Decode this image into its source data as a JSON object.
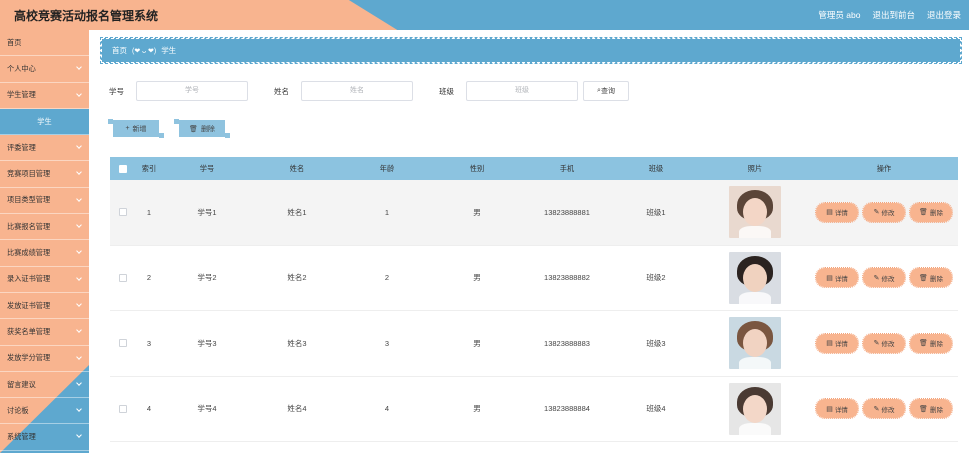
{
  "header": {
    "title": "高校竞赛活动报名管理系统",
    "admin": "管理员 abo",
    "front": "退出到前台",
    "logout": "退出登录"
  },
  "sidebar": {
    "items": [
      {
        "label": "首页",
        "chev": false,
        "active": false
      },
      {
        "label": "个人中心",
        "chev": true,
        "active": false
      },
      {
        "label": "学生管理",
        "chev": true,
        "active": false
      },
      {
        "label": "学生",
        "chev": false,
        "active": true
      },
      {
        "label": "评委管理",
        "chev": true,
        "active": false
      },
      {
        "label": "竞赛项目管理",
        "chev": true,
        "active": false
      },
      {
        "label": "项目类型管理",
        "chev": true,
        "active": false
      },
      {
        "label": "比赛报名管理",
        "chev": true,
        "active": false
      },
      {
        "label": "比赛成绩管理",
        "chev": true,
        "active": false
      },
      {
        "label": "录入证书管理",
        "chev": true,
        "active": false
      },
      {
        "label": "发放证书管理",
        "chev": true,
        "active": false
      },
      {
        "label": "获奖名单管理",
        "chev": true,
        "active": false
      },
      {
        "label": "发放学分管理",
        "chev": true,
        "active": false
      },
      {
        "label": "留言建议",
        "chev": true,
        "active": false
      },
      {
        "label": "讨论板",
        "chev": true,
        "active": false
      },
      {
        "label": "系统管理",
        "chev": true,
        "active": false
      }
    ]
  },
  "breadcrumb": {
    "home": "首页",
    "sep": "(❤ ᴗ ❤)",
    "current": "学生"
  },
  "search": {
    "no_label": "学号",
    "no_placeholder": "学号",
    "name_label": "姓名",
    "name_placeholder": "姓名",
    "class_label": "班级",
    "class_placeholder": "班级",
    "button": "查询"
  },
  "actions": {
    "add": "新增",
    "delete": "删除"
  },
  "table": {
    "headers": [
      "索引",
      "学号",
      "姓名",
      "年龄",
      "性别",
      "手机",
      "班级",
      "照片",
      "操作"
    ],
    "rows": [
      {
        "idx": "1",
        "no": "学号1",
        "name": "姓名1",
        "age": "1",
        "sex": "男",
        "phone": "13823888881",
        "cls": "班级1"
      },
      {
        "idx": "2",
        "no": "学号2",
        "name": "姓名2",
        "age": "2",
        "sex": "男",
        "phone": "13823888882",
        "cls": "班级2"
      },
      {
        "idx": "3",
        "no": "学号3",
        "name": "姓名3",
        "age": "3",
        "sex": "男",
        "phone": "13823888883",
        "cls": "班级3"
      },
      {
        "idx": "4",
        "no": "学号4",
        "name": "姓名4",
        "age": "4",
        "sex": "男",
        "phone": "13823888884",
        "cls": "班级4"
      }
    ],
    "ops": {
      "detail": "详情",
      "edit": "修改",
      "delete": "删除"
    }
  },
  "colors": {
    "peach": "#f8b48f",
    "blue": "#5ea8cf",
    "header_row": "#8cc3e0"
  }
}
